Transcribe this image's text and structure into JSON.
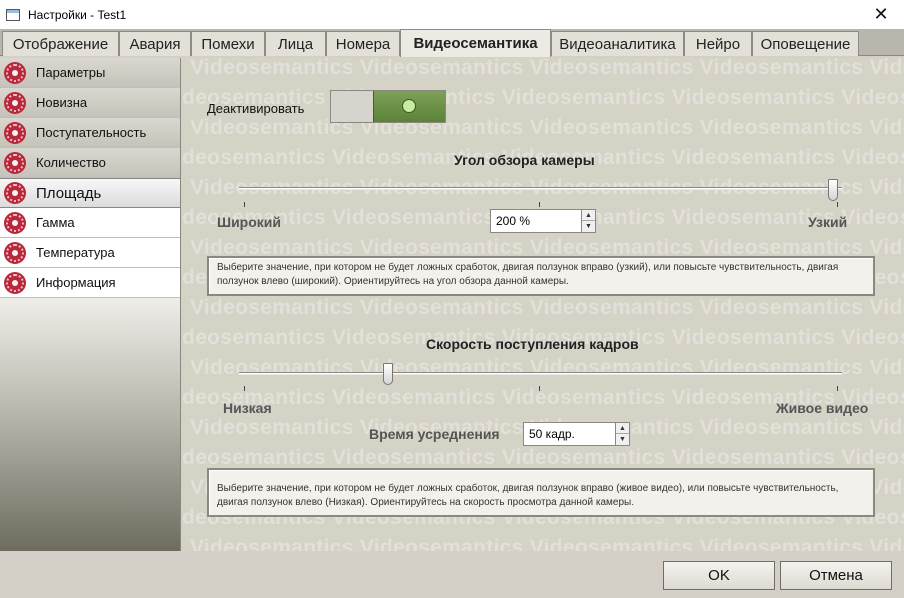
{
  "window": {
    "title": "Настройки - Test1"
  },
  "tabs": [
    {
      "label": "Отображение"
    },
    {
      "label": "Авария"
    },
    {
      "label": "Помехи"
    },
    {
      "label": "Лица"
    },
    {
      "label": "Номера"
    },
    {
      "label": "Видеосемантика",
      "active": true
    },
    {
      "label": "Видеоаналитика"
    },
    {
      "label": "Нейро"
    },
    {
      "label": "Оповещение"
    }
  ],
  "sidebar": {
    "items": [
      {
        "label": "Параметры"
      },
      {
        "label": "Новизна"
      },
      {
        "label": "Поступательность"
      },
      {
        "label": "Количество"
      },
      {
        "label": "Площадь",
        "active": true
      },
      {
        "label": "Гамма"
      },
      {
        "label": "Температура"
      },
      {
        "label": "Информация"
      }
    ]
  },
  "watermark": {
    "text": "Videosemantics"
  },
  "main": {
    "deactivate_label": "Деактивировать",
    "toggle_on": true,
    "camera_angle": {
      "title": "Угол обзора камеры",
      "min_label": "Широкий",
      "max_label": "Узкий",
      "value": "200 %",
      "slider_position": 1.0,
      "hint": "Выберите значение, при котором не будет ложных сработок, двигая ползунок вправо (узкий), или повысьте чувствительность, двигая ползунок влево (широкий). Ориентируйтесь на угол обзора данной камеры."
    },
    "frame_rate": {
      "title": "Скорость поступления кадров",
      "min_label": "Низкая",
      "max_label": "Живое видео",
      "averaging_label": "Время усреднения",
      "averaging_value": "50 кадр.",
      "slider_position": 0.25,
      "hint": "Выберите значение, при котором не будет ложных сработок, двигая ползунок вправо (живое видео), или повысьте чувствительность, двигая ползунок влево (Низкая). Ориентируйтесь на скорость просмотра данной камеры."
    }
  },
  "footer": {
    "ok_label": "OK",
    "cancel_label": "Отмена"
  }
}
